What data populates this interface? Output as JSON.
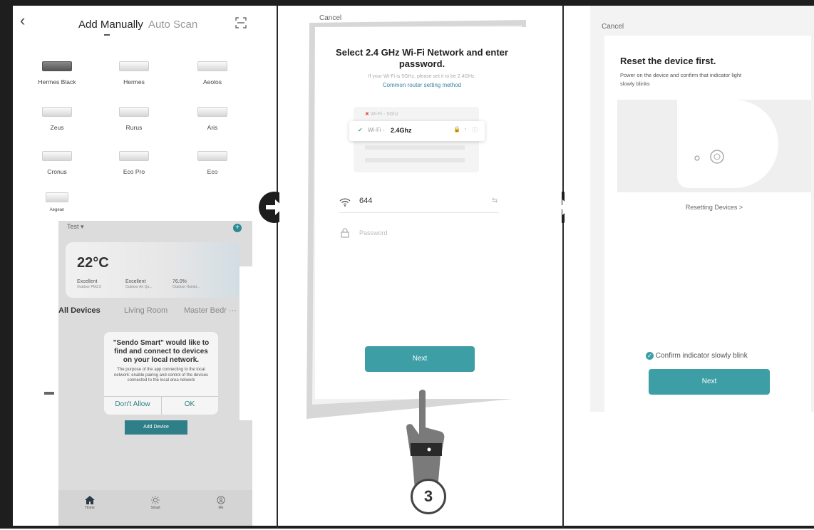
{
  "colors": {
    "accent": "#3d9ea5",
    "frame": "#1e1e1e",
    "link": "#3a7fa4"
  },
  "panel1": {
    "back_icon": "chevron-left-icon",
    "tab_manual": "Add Manually",
    "tab_auto": "Auto Scan",
    "scan_icon": "scan-icon",
    "devices": [
      "Hermes Black",
      "Hermes",
      "Aeolos",
      "Zeus",
      "Rurus",
      "Aris",
      "Cronus",
      "Eco Pro",
      "Eco",
      "Aegean"
    ],
    "phone": {
      "home": "Test ▾",
      "temperature": "22°C",
      "metrics": [
        {
          "value": "Excellent",
          "label": "Outdoor PM2.5"
        },
        {
          "value": "Excellent",
          "label": "Outdoor Air Qu..."
        },
        {
          "value": "76.0%",
          "label": "Outdoor Humid..."
        }
      ],
      "rooms": [
        "All Devices",
        "Living Room",
        "Master Bedr ···"
      ],
      "dialog": {
        "title": "\"Sendo Smart\" would like to find and connect to devices on your local network.",
        "body": "The purpose of the app connecting to the local network: enable pairing and control of the devices connected to the local area network",
        "deny": "Don't Allow",
        "ok": "OK"
      },
      "add_device": "Add Device",
      "nav": [
        {
          "icon": "home-icon",
          "label": "Home"
        },
        {
          "icon": "sun-icon",
          "label": "Smart"
        },
        {
          "icon": "user-icon",
          "label": "Me"
        }
      ]
    }
  },
  "panel2": {
    "cancel": "Cancel",
    "title": "Select 2.4 GHz Wi-Fi Network and enter password.",
    "hint": "If your Wi-Fi is 5GHz, please set it to be 2.4GHz.",
    "router_link": "Common router setting method",
    "wifi_5g": "Wi-Fi - 5Ghz",
    "wifi_24_prefix": "Wi-Fi - ",
    "wifi_24": "2.4Ghz",
    "ssid": "644",
    "password_placeholder": "Password",
    "next": "Next",
    "step": "3"
  },
  "panel3": {
    "cancel": "Cancel",
    "title": "Reset the device first.",
    "body": "Power on the device and confirm that indicator light slowly blinks",
    "resetting": "Resetting Devices >",
    "confirm": "Confirm indicator slowly blink",
    "next": "Next"
  }
}
